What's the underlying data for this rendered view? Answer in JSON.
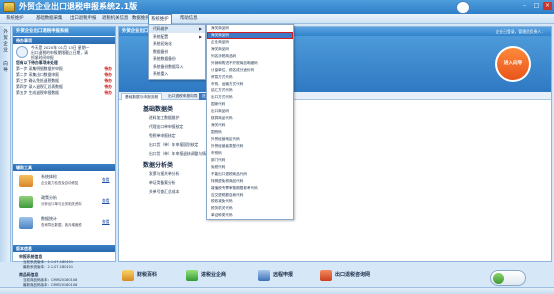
{
  "window": {
    "title": "外贸企业出口退税申报系统2.1版",
    "minimize": "–",
    "maximize": "□",
    "close": "×"
  },
  "menubar": [
    "系统维护",
    "基础数据采集",
    "出口退税申报",
    "退税机关信息",
    "数据维护",
    "系统维护",
    "帮助信息"
  ],
  "system_menu": {
    "items": [
      "代码维护",
      "系统配置",
      "系统初始化",
      "数据备份",
      "系统数据备份",
      "系统备份数据导入",
      "系统重入"
    ],
    "submenu": [
      "海关商品码",
      "海关商品码",
      "企业商品码",
      "海关商品码",
      "列名涉税商品码",
      "外销和购进不开税商品明细码",
      "计量单位、税名成分适价码",
      "贸易方式代码",
      "币别、运输方式代码",
      "结汇方式代码",
      "出口方式代码",
      "国家代码",
      "出口商品码",
      "核算商品代码",
      "海关代码",
      "国别码",
      "外贸经营地区代码",
      "外贸经营者类型代码",
      "币别码",
      "部门代码",
      "免税代码",
      "不能出口退税商品代码",
      "特殊退免税商品代码",
      "增值税专票审核期限参考代码",
      "应交退税额自我代码",
      "税收减免代码",
      "税务机关代码",
      "单证种类代码"
    ],
    "highlighted_index": 1
  },
  "left": {
    "vtab_labels": [
      "外贸企业出口退税申报系统",
      "向导"
    ],
    "header": "外贸企业出口退税申报系统",
    "task_header": "待办事项",
    "greeting": "今天是 2020年 01月 13日 星期一",
    "greeting2": "出口退税的申报期限截止日期，请",
    "greeting3": "抓紧时间申报",
    "notice": "您有以下待办事项未处理",
    "tasks": [
      {
        "label": "第一步 采集明细数据并申报",
        "status": "待办"
      },
      {
        "label": "第二步 采集出口数据申报",
        "status": "待办"
      },
      {
        "label": "第三步 确认免抵退税数据",
        "status": "待办"
      },
      {
        "label": "第四步 录入退税汇总表数据",
        "status": "待办"
      },
      {
        "label": "第五步 生成退税申报数据",
        "status": "待办"
      }
    ],
    "tools_header": "辅助工具",
    "tools": [
      {
        "title": "系统体检",
        "desc": "企业能力检查及自动修复",
        "link": "查看"
      },
      {
        "title": "政策分析",
        "desc": "分析出口单与业务相关资料",
        "link": "查看"
      },
      {
        "title": "数据统计",
        "desc": "查询导出数据，各月增值税",
        "link": "查看"
      }
    ],
    "version_header": "版本信息",
    "app_info_title": "申报系统信息",
    "app_lines": [
      "当前系统版本：2.1.07.180101",
      "最新系统版本：2.1.07.180101"
    ],
    "db_info_title": "商品码信息",
    "db_lines": [
      "当前商品码版本：CMM20180108",
      "最新商品码版本：CMM20180108"
    ]
  },
  "main": {
    "header": "外贸企业出口退税申报系统",
    "right_header": "企业已登录，管理员负责人：",
    "guide_btn": "进入向导",
    "tabs": [
      "基础数据与申报流程",
      "出口退税申报向导",
      "进入向导"
    ],
    "basic_title": "基础数据类",
    "basic_items": [
      "进料加工数据维护",
      "代理出口单申报核定",
      "免税单申报核定",
      "出口货（单）年申报国别核定",
      "出口货（单）年申报退核调整与情况"
    ],
    "analysis_title": "数据分析类",
    "analysis_items": [
      "发票与报关单分析",
      "单证类备案分析",
      "关单号查汇总成本"
    ]
  },
  "bottom": [
    "财税百科",
    "进税业企商",
    "远程申报",
    "出口退税咨询网"
  ],
  "status": {}
}
